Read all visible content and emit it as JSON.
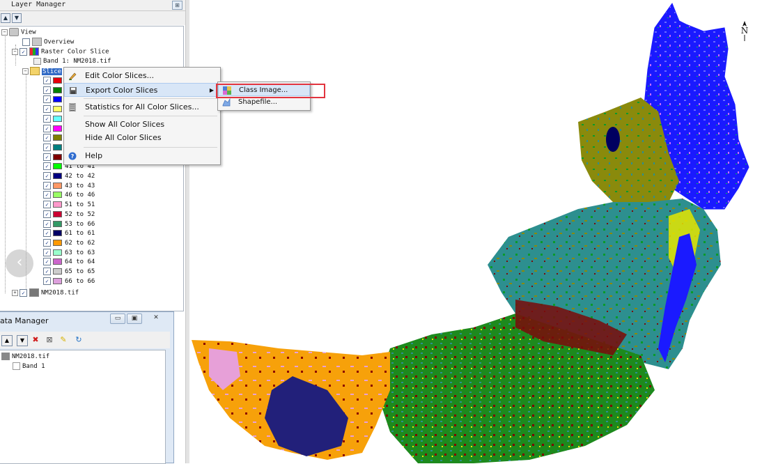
{
  "layer_manager": {
    "title": "Layer Manager",
    "tree": {
      "view_label": "View",
      "overview_label": "Overview",
      "raster_label": "Raster Color Slice",
      "band_label": "Band 1: NM2018.tif",
      "slices_label": "Slice",
      "nm_label": "NM2018.tif",
      "slices": [
        {
          "label": "",
          "color": "#e8000b"
        },
        {
          "label": "",
          "color": "#008000"
        },
        {
          "label": "",
          "color": "#0000ff"
        },
        {
          "label": "",
          "color": "#ffff66"
        },
        {
          "label": "",
          "color": "#66ffff"
        },
        {
          "label": "",
          "color": "#ff00ff"
        },
        {
          "label": "",
          "color": "#808000"
        },
        {
          "label": "",
          "color": "#008080"
        },
        {
          "label": "",
          "color": "#800000"
        },
        {
          "label": "41 to 41",
          "color": "#00ff00"
        },
        {
          "label": "42 to 42",
          "color": "#000080"
        },
        {
          "label": "43 to 43",
          "color": "#ff9966"
        },
        {
          "label": "46 to 46",
          "color": "#99ff66"
        },
        {
          "label": "51 to 51",
          "color": "#ff99cc"
        },
        {
          "label": "52 to 52",
          "color": "#cc0033"
        },
        {
          "label": "53 to 66",
          "color": "#339966"
        },
        {
          "label": "61 to 61",
          "color": "#000066"
        },
        {
          "label": "62 to 62",
          "color": "#ff9900"
        },
        {
          "label": "63 to 63",
          "color": "#99ffcc"
        },
        {
          "label": "64 to 64",
          "color": "#cc66cc"
        },
        {
          "label": "65 to 65",
          "color": "#cccccc"
        },
        {
          "label": "66 to 66",
          "color": "#dda0dd"
        }
      ]
    }
  },
  "context_menu": {
    "items": [
      {
        "label": "Edit Color Slices...",
        "icon": "pencil-icon"
      },
      {
        "label": "Export Color Slices",
        "icon": "export-icon"
      },
      {
        "label": "Statistics for All Color Slices...",
        "icon": "stats-icon"
      },
      {
        "label": "Show All Color Slices",
        "icon": ""
      },
      {
        "label": "Hide All Color Slices",
        "icon": ""
      },
      {
        "label": "Help",
        "icon": "help-icon"
      }
    ],
    "submenu": [
      {
        "label": "Class Image...",
        "icon": "class-image-icon"
      },
      {
        "label": "Shapefile...",
        "icon": "shapefile-icon"
      }
    ]
  },
  "data_manager": {
    "title": "ata Manager",
    "file_label": "NM2018.tif",
    "band_label": "Band 1"
  },
  "map": {
    "north_label": "N"
  },
  "colors": {
    "highlight": "#e2343f",
    "selection": "#316ac5"
  }
}
